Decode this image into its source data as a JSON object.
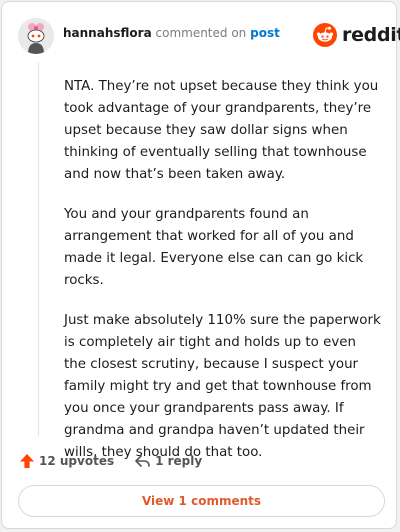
{
  "header": {
    "username": "hannahsflora",
    "action_text": "commented on",
    "post_link": "post"
  },
  "brand": {
    "name": "reddit",
    "icon": "reddit-snoo-icon",
    "color": "#ff4500"
  },
  "comment": {
    "paragraphs": [
      "NTA. They’re not upset because they think you took advantage of your grandparents, they’re upset because they saw dollar signs when thinking of eventually selling that townhouse and now that’s been taken away.",
      "You and your grandparents found an arrangement that worked for all of you and made it legal. Everyone else can can go kick rocks.",
      "Just make absolutely 110% sure the paperwork is completely air tight and holds up to even the closest scrutiny, because I suspect your family might try and get that townhouse from you once your grandparents pass away. If grandma and grandpa haven’t updated their wills, they should do that too."
    ]
  },
  "actions": {
    "upvotes_label": "12 upvotes",
    "upvote_icon": "upvote-arrow-icon",
    "reply_label": "1 reply",
    "reply_icon": "reply-arrow-icon",
    "upvote_color": "#ff4500"
  },
  "footer": {
    "view_comments_label": "View 1 comments",
    "accent_color": "#e05a2b"
  }
}
